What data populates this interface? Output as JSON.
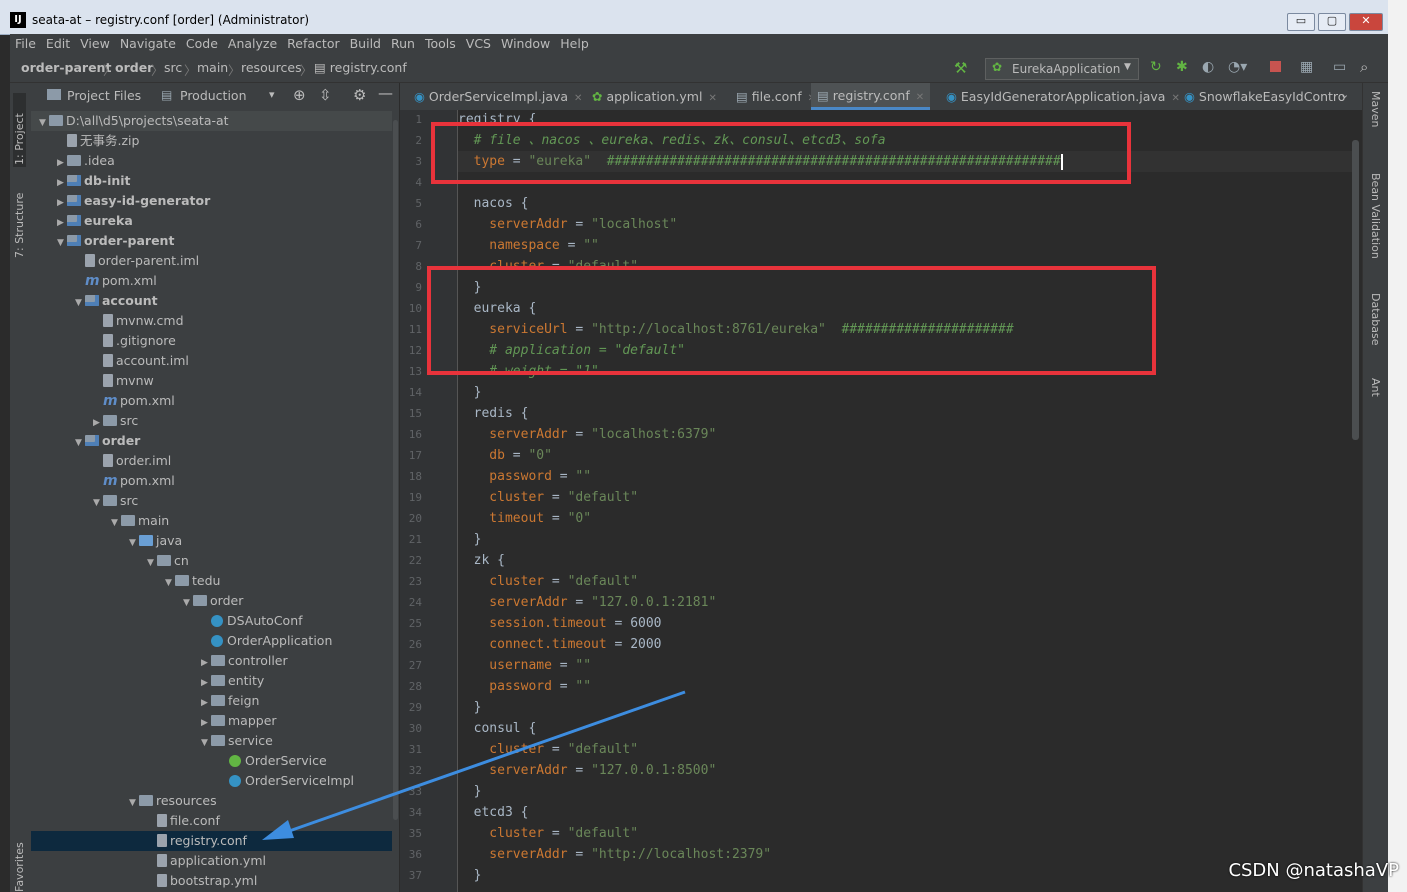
{
  "window": {
    "title": "seata-at – registry.conf [order] (Administrator)",
    "logo": "IJ",
    "buttons": [
      "▭",
      "▢",
      "✕"
    ]
  },
  "menu": [
    "File",
    "Edit",
    "View",
    "Navigate",
    "Code",
    "Analyze",
    "Refactor",
    "Build",
    "Run",
    "Tools",
    "VCS",
    "Window",
    "Help"
  ],
  "breadcrumb": [
    "order-parent",
    "order",
    "src",
    "main",
    "resources",
    "registry.conf"
  ],
  "run_config": "EurekaApplication",
  "project_panel": {
    "tab_project": "Project Files",
    "tab_production": "Production",
    "left_tabs": [
      "1: Project",
      "7: Structure",
      "Favorites"
    ],
    "tree": [
      {
        "label": "D:\\all\\d5\\projects\\seata-at",
        "depth": 0,
        "arrow": "▼",
        "icon": "folder"
      },
      {
        "label": "无事务.zip",
        "depth": 1,
        "arrow": "",
        "icon": "file"
      },
      {
        "label": ".idea",
        "depth": 1,
        "arrow": "▶",
        "icon": "folder"
      },
      {
        "label": "db-init",
        "depth": 1,
        "arrow": "▶",
        "icon": "module",
        "bold": true
      },
      {
        "label": "easy-id-generator",
        "depth": 1,
        "arrow": "▶",
        "icon": "module",
        "bold": true
      },
      {
        "label": "eureka",
        "depth": 1,
        "arrow": "▶",
        "icon": "module",
        "bold": true
      },
      {
        "label": "order-parent",
        "depth": 1,
        "arrow": "▼",
        "icon": "module",
        "bold": true
      },
      {
        "label": "order-parent.iml",
        "depth": 2,
        "arrow": "",
        "icon": "file"
      },
      {
        "label": "pom.xml",
        "depth": 2,
        "arrow": "",
        "icon": "maven"
      },
      {
        "label": "account",
        "depth": 2,
        "arrow": "▼",
        "icon": "module",
        "bold": true
      },
      {
        "label": "mvnw.cmd",
        "depth": 3,
        "arrow": "",
        "icon": "file"
      },
      {
        "label": ".gitignore",
        "depth": 3,
        "arrow": "",
        "icon": "file"
      },
      {
        "label": "account.iml",
        "depth": 3,
        "arrow": "",
        "icon": "file"
      },
      {
        "label": "mvnw",
        "depth": 3,
        "arrow": "",
        "icon": "file"
      },
      {
        "label": "pom.xml",
        "depth": 3,
        "arrow": "",
        "icon": "maven"
      },
      {
        "label": "src",
        "depth": 3,
        "arrow": "▶",
        "icon": "folder"
      },
      {
        "label": "order",
        "depth": 2,
        "arrow": "▼",
        "icon": "module",
        "bold": true
      },
      {
        "label": "order.iml",
        "depth": 3,
        "arrow": "",
        "icon": "file"
      },
      {
        "label": "pom.xml",
        "depth": 3,
        "arrow": "",
        "icon": "maven"
      },
      {
        "label": "src",
        "depth": 3,
        "arrow": "▼",
        "icon": "folder"
      },
      {
        "label": "main",
        "depth": 4,
        "arrow": "▼",
        "icon": "folder"
      },
      {
        "label": "java",
        "depth": 5,
        "arrow": "▼",
        "icon": "folder-blue"
      },
      {
        "label": "cn",
        "depth": 6,
        "arrow": "▼",
        "icon": "folder"
      },
      {
        "label": "tedu",
        "depth": 7,
        "arrow": "▼",
        "icon": "folder"
      },
      {
        "label": "order",
        "depth": 8,
        "arrow": "▼",
        "icon": "folder"
      },
      {
        "label": "DSAutoConf",
        "depth": 9,
        "arrow": "",
        "icon": "class"
      },
      {
        "label": "OrderApplication",
        "depth": 9,
        "arrow": "",
        "icon": "class"
      },
      {
        "label": "controller",
        "depth": 9,
        "arrow": "▶",
        "icon": "folder"
      },
      {
        "label": "entity",
        "depth": 9,
        "arrow": "▶",
        "icon": "folder"
      },
      {
        "label": "feign",
        "depth": 9,
        "arrow": "▶",
        "icon": "folder"
      },
      {
        "label": "mapper",
        "depth": 9,
        "arrow": "▶",
        "icon": "folder"
      },
      {
        "label": "service",
        "depth": 9,
        "arrow": "▼",
        "icon": "folder"
      },
      {
        "label": "OrderService",
        "depth": 10,
        "arrow": "",
        "icon": "interface"
      },
      {
        "label": "OrderServiceImpl",
        "depth": 10,
        "arrow": "",
        "icon": "class"
      },
      {
        "label": "resources",
        "depth": 5,
        "arrow": "▼",
        "icon": "folder"
      },
      {
        "label": "file.conf",
        "depth": 6,
        "arrow": "",
        "icon": "file"
      },
      {
        "label": "registry.conf",
        "depth": 6,
        "arrow": "",
        "icon": "file",
        "selected": true
      },
      {
        "label": "application.yml",
        "depth": 6,
        "arrow": "",
        "icon": "file"
      },
      {
        "label": "bootstrap.yml",
        "depth": 6,
        "arrow": "",
        "icon": "file"
      }
    ]
  },
  "editor_tabs": [
    {
      "label": "OrderServiceImpl.java",
      "active": false
    },
    {
      "label": "application.yml",
      "active": false
    },
    {
      "label": "file.conf",
      "active": false
    },
    {
      "label": "registry.conf",
      "active": true
    },
    {
      "label": "EasyIdGeneratorApplication.java",
      "active": false
    },
    {
      "label": "SnowflakeEasyIdContro",
      "active": false
    }
  ],
  "right_tabs": [
    "Maven",
    "Bean Validation",
    "Database",
    "Ant"
  ],
  "code_lines": [
    {
      "n": "1",
      "t": [
        [
          "n",
          "registry {"
        ]
      ]
    },
    {
      "n": "2",
      "t": [
        [
          "cm",
          "  # file 、nacos 、eureka、redis、zk、consul、etcd3、sofa"
        ]
      ]
    },
    {
      "n": "3",
      "t": [
        [
          "k",
          "  type"
        ],
        [
          "n",
          " = "
        ],
        [
          "s",
          "\"eureka\""
        ],
        [
          "cm",
          "  ##########################################################"
        ]
      ],
      "cur": true
    },
    {
      "n": "4",
      "t": []
    },
    {
      "n": "5",
      "t": [
        [
          "n",
          "  nacos {"
        ]
      ]
    },
    {
      "n": "6",
      "t": [
        [
          "k",
          "    serverAddr"
        ],
        [
          "n",
          " = "
        ],
        [
          "s",
          "\"localhost\""
        ]
      ]
    },
    {
      "n": "7",
      "t": [
        [
          "k",
          "    namespace"
        ],
        [
          "n",
          " = "
        ],
        [
          "s",
          "\"\""
        ]
      ]
    },
    {
      "n": "8",
      "t": [
        [
          "k",
          "    cluster"
        ],
        [
          "n",
          " = "
        ],
        [
          "s",
          "\"default\""
        ]
      ]
    },
    {
      "n": "9",
      "t": [
        [
          "n",
          "  }"
        ]
      ]
    },
    {
      "n": "10",
      "t": [
        [
          "n",
          "  eureka {"
        ]
      ]
    },
    {
      "n": "11",
      "t": [
        [
          "k",
          "    serviceUrl"
        ],
        [
          "n",
          " = "
        ],
        [
          "s",
          "\"http://localhost:8761/eureka\""
        ],
        [
          "cm",
          "  ######################"
        ]
      ]
    },
    {
      "n": "12",
      "t": [
        [
          "cm",
          "    # application = \"default\""
        ]
      ]
    },
    {
      "n": "13",
      "t": [
        [
          "cm",
          "    # weight = \"1\""
        ]
      ]
    },
    {
      "n": "14",
      "t": [
        [
          "n",
          "  }"
        ]
      ]
    },
    {
      "n": "15",
      "t": [
        [
          "n",
          "  redis {"
        ]
      ]
    },
    {
      "n": "16",
      "t": [
        [
          "k",
          "    serverAddr"
        ],
        [
          "n",
          " = "
        ],
        [
          "s",
          "\"localhost:6379\""
        ]
      ]
    },
    {
      "n": "17",
      "t": [
        [
          "k",
          "    db"
        ],
        [
          "n",
          " = "
        ],
        [
          "s",
          "\"0\""
        ]
      ]
    },
    {
      "n": "18",
      "t": [
        [
          "k",
          "    password"
        ],
        [
          "n",
          " = "
        ],
        [
          "s",
          "\"\""
        ]
      ]
    },
    {
      "n": "19",
      "t": [
        [
          "k",
          "    cluster"
        ],
        [
          "n",
          " = "
        ],
        [
          "s",
          "\"default\""
        ]
      ]
    },
    {
      "n": "20",
      "t": [
        [
          "k",
          "    timeout"
        ],
        [
          "n",
          " = "
        ],
        [
          "s",
          "\"0\""
        ]
      ]
    },
    {
      "n": "21",
      "t": [
        [
          "n",
          "  }"
        ]
      ]
    },
    {
      "n": "22",
      "t": [
        [
          "n",
          "  zk {"
        ]
      ]
    },
    {
      "n": "23",
      "t": [
        [
          "k",
          "    cluster"
        ],
        [
          "n",
          " = "
        ],
        [
          "s",
          "\"default\""
        ]
      ]
    },
    {
      "n": "24",
      "t": [
        [
          "k",
          "    serverAddr"
        ],
        [
          "n",
          " = "
        ],
        [
          "s",
          "\"127.0.0.1:2181\""
        ]
      ]
    },
    {
      "n": "25",
      "t": [
        [
          "k",
          "    session.timeout"
        ],
        [
          "n",
          " = 6000"
        ]
      ]
    },
    {
      "n": "26",
      "t": [
        [
          "k",
          "    connect.timeout"
        ],
        [
          "n",
          " = 2000"
        ]
      ]
    },
    {
      "n": "27",
      "t": [
        [
          "k",
          "    username"
        ],
        [
          "n",
          " = "
        ],
        [
          "s",
          "\"\""
        ]
      ]
    },
    {
      "n": "28",
      "t": [
        [
          "k",
          "    password"
        ],
        [
          "n",
          " = "
        ],
        [
          "s",
          "\"\""
        ]
      ]
    },
    {
      "n": "29",
      "t": [
        [
          "n",
          "  }"
        ]
      ]
    },
    {
      "n": "30",
      "t": [
        [
          "n",
          "  consul {"
        ]
      ]
    },
    {
      "n": "31",
      "t": [
        [
          "k",
          "    cluster"
        ],
        [
          "n",
          " = "
        ],
        [
          "s",
          "\"default\""
        ]
      ]
    },
    {
      "n": "32",
      "t": [
        [
          "k",
          "    serverAddr"
        ],
        [
          "n",
          " = "
        ],
        [
          "s",
          "\"127.0.0.1:8500\""
        ]
      ]
    },
    {
      "n": "33",
      "t": [
        [
          "n",
          "  }"
        ]
      ]
    },
    {
      "n": "34",
      "t": [
        [
          "n",
          "  etcd3 {"
        ]
      ]
    },
    {
      "n": "35",
      "t": [
        [
          "k",
          "    cluster"
        ],
        [
          "n",
          " = "
        ],
        [
          "s",
          "\"default\""
        ]
      ]
    },
    {
      "n": "36",
      "t": [
        [
          "k",
          "    serverAddr"
        ],
        [
          "n",
          " = "
        ],
        [
          "s",
          "\"http://localhost:2379\""
        ]
      ]
    },
    {
      "n": "37",
      "t": [
        [
          "n",
          "  }"
        ]
      ]
    }
  ],
  "watermark": "CSDN @natashaVP",
  "colors": {
    "highlight_box": "#e8333b",
    "arrow": "#3d8de0",
    "selection": "#0d293e"
  }
}
